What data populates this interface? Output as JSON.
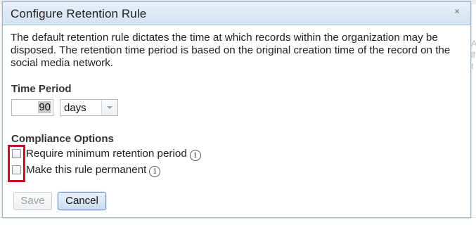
{
  "dialog": {
    "title": "Configure Retention Rule",
    "close_glyph": "×",
    "description": "The default retention rule dictates the time at which records within the organization may be disposed. The retention time period is based on the original creation time of the record on the social media network."
  },
  "time_period": {
    "heading": "Time Period",
    "value": "90",
    "unit_selected": "days"
  },
  "compliance": {
    "heading": "Compliance Options",
    "options": [
      {
        "label": "Require minimum retention period",
        "checked": false,
        "icon": "info-icon"
      },
      {
        "label": "Make this rule permanent",
        "checked": false,
        "icon": "info-icon"
      }
    ]
  },
  "buttons": {
    "save_label": "Save",
    "cancel_label": "Cancel"
  },
  "colors": {
    "highlight": "#c8102e",
    "titlebar": "#d4e2f1",
    "cancel_border": "#6d95c2"
  }
}
